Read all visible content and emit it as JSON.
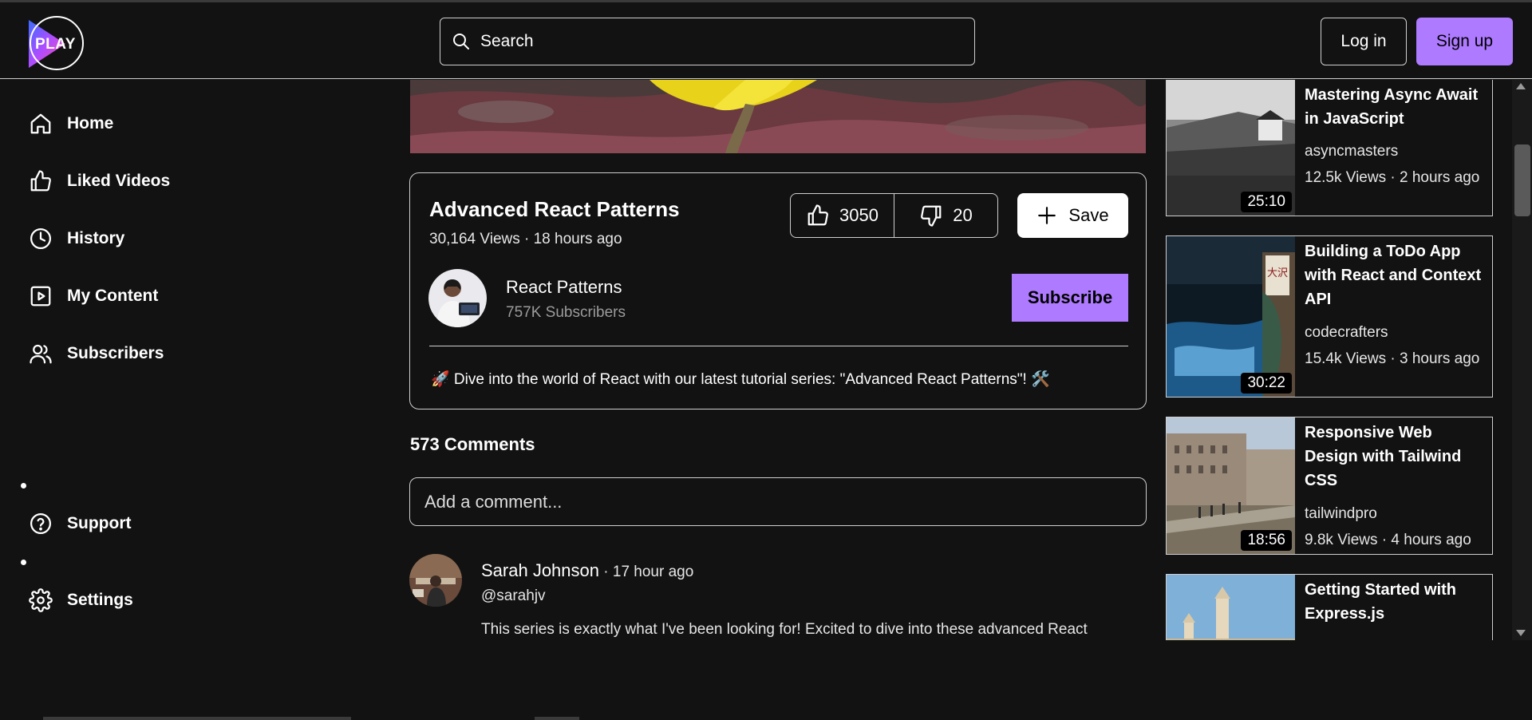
{
  "header": {
    "logo_text": "PLAY",
    "search_placeholder": "Search",
    "login_label": "Log in",
    "signup_label": "Sign up"
  },
  "sidebar": {
    "items": [
      {
        "label": "Home",
        "icon": "home-icon"
      },
      {
        "label": "Liked Videos",
        "icon": "thumbs-up-icon"
      },
      {
        "label": "History",
        "icon": "clock-icon"
      },
      {
        "label": "My Content",
        "icon": "play-square-icon"
      },
      {
        "label": "Subscribers",
        "icon": "users-icon"
      },
      {
        "label": "Support",
        "icon": "help-circle-icon"
      },
      {
        "label": "Settings",
        "icon": "gear-icon"
      }
    ]
  },
  "video": {
    "title": "Advanced React Patterns",
    "meta": "30,164 Views · 18 hours ago",
    "likes": "3050",
    "dislikes": "20",
    "save_label": "Save",
    "channel_name": "React Patterns",
    "channel_subs": "757K Subscribers",
    "subscribe_label": "Subscribe",
    "description": "🚀 Dive into the world of React with our latest tutorial series: \"Advanced React Patterns\"! 🛠️"
  },
  "comments": {
    "count_label": "573 Comments",
    "add_placeholder": "Add a comment...",
    "items": [
      {
        "author": "Sarah Johnson",
        "time": " · 17 hour ago",
        "handle": "@sarahjv",
        "text": "This series is exactly what I've been looking for! Excited to dive into these advanced React"
      }
    ]
  },
  "recommended": [
    {
      "title": "Mastering Async Await in JavaScript",
      "channel": "asyncmasters",
      "meta": "12.5k Views · 2 hours ago",
      "duration": "25:10"
    },
    {
      "title": "Building a ToDo App with React and Context API",
      "channel": "codecrafters",
      "meta": "15.4k Views · 3 hours ago",
      "duration": "30:22"
    },
    {
      "title": "Responsive Web Design with Tailwind CSS",
      "channel": "tailwindpro",
      "meta": "9.8k Views · 4 hours ago",
      "duration": "18:56"
    },
    {
      "title": "Getting Started with Express.js",
      "channel": "",
      "meta": "",
      "duration": ""
    }
  ],
  "colors": {
    "background": "#121212",
    "accent": "#ae7aff",
    "border": "#cfcfcf"
  }
}
